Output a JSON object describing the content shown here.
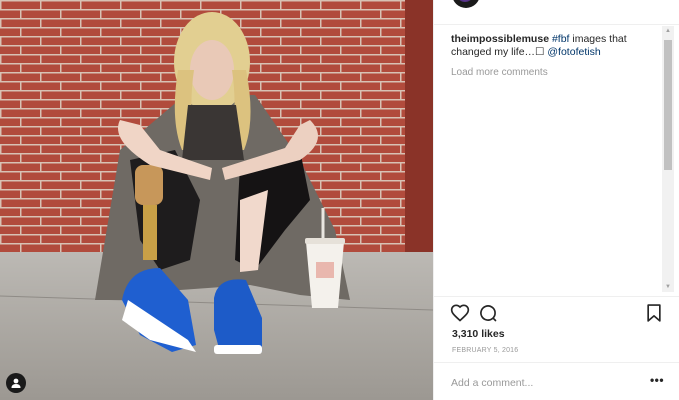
{
  "post": {
    "image_alt": "Woman with blonde hair and a prosthetic leg sitting against a red brick wall with a soda cup"
  },
  "caption": {
    "username": "theimpossiblemuse",
    "hashtag": "#fbf",
    "text": " images that changed my life…",
    "emoji": "☐",
    "mention": "@fotofetish"
  },
  "comments": {
    "load_more_label": "Load more comments"
  },
  "stats": {
    "likes": "3,310 likes",
    "date": "FEBRUARY 5, 2016"
  },
  "comment_input": {
    "placeholder": "Add a comment..."
  },
  "menu": {
    "more_label": "•••"
  },
  "icons": {
    "like": "heart-icon",
    "comment": "comment-bubble-icon",
    "save": "bookmark-icon",
    "user_tag": "user-tag-icon",
    "more": "more-options-icon"
  },
  "colors": {
    "link": "#003569",
    "muted": "#999999",
    "text": "#262626",
    "brick": "#a54437"
  }
}
